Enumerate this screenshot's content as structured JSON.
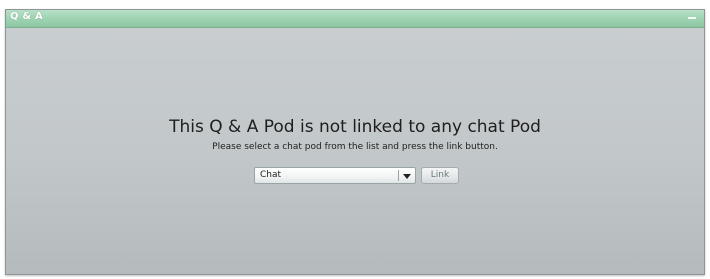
{
  "pod": {
    "title": "Q & A",
    "heading": "This Q & A Pod is not linked to any chat Pod",
    "instruction": "Please select a chat pod from the list and press the link button.",
    "chat_select": {
      "selected": "Chat"
    },
    "link_button_label": "Link"
  },
  "icons": {
    "minimize": "minimize-icon",
    "dropdown": "chevron-down-icon"
  },
  "colors": {
    "titlebar": "#9fd3b3",
    "title_text": "#ffffff",
    "panel_background": "#c2c7c9",
    "text": "#1e1e1e",
    "disabled_text": "#6d7578"
  }
}
